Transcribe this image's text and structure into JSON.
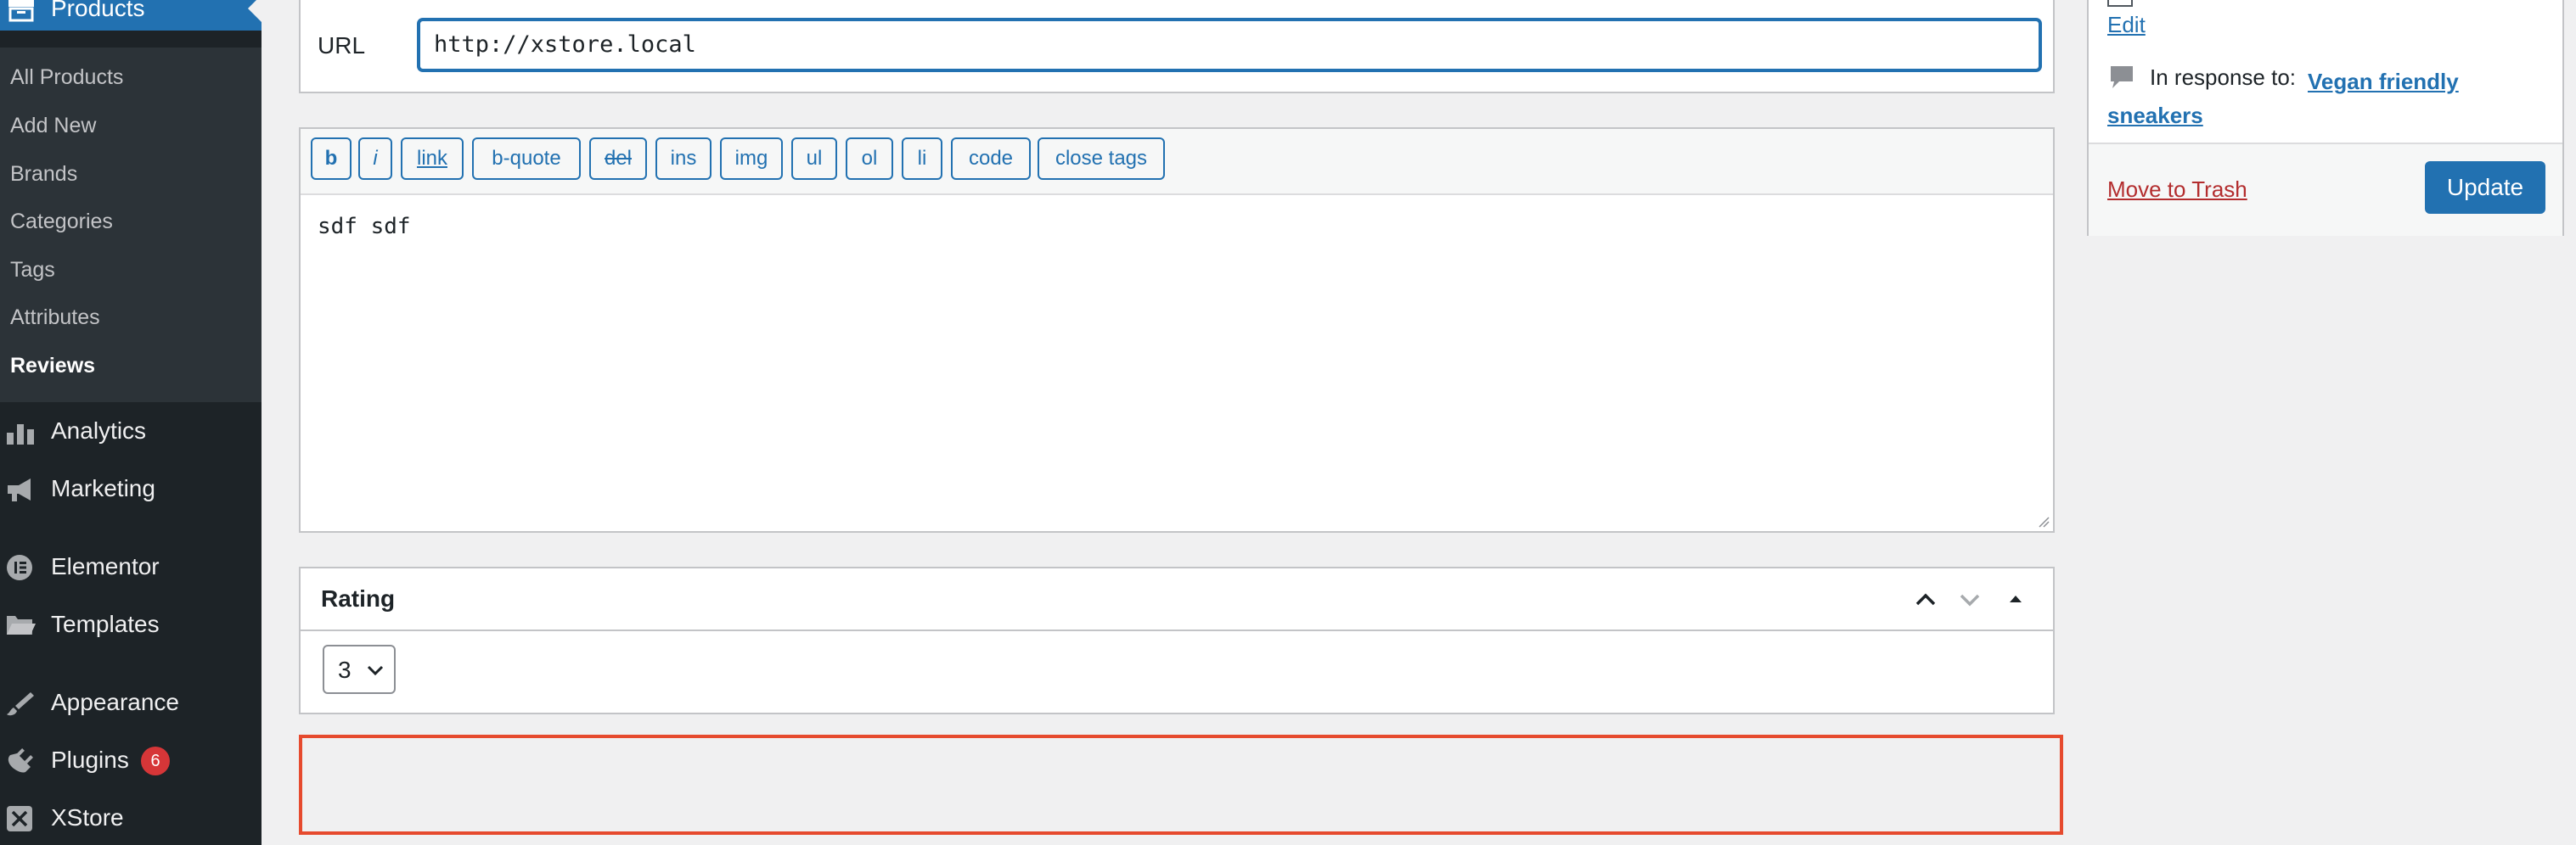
{
  "sidebar": {
    "products_label": "Products",
    "submenu": {
      "all_products": "All Products",
      "add_new": "Add New",
      "brands": "Brands",
      "categories": "Categories",
      "tags": "Tags",
      "attributes": "Attributes",
      "reviews": "Reviews"
    },
    "menu": {
      "analytics": "Analytics",
      "marketing": "Marketing",
      "elementor": "Elementor",
      "templates": "Templates",
      "appearance": "Appearance",
      "plugins": "Plugins",
      "plugins_badge": "6",
      "xstore": "XStore"
    }
  },
  "url_field": {
    "label": "URL",
    "value": "http://xstore.local"
  },
  "editor": {
    "toolbar": {
      "b": "b",
      "i": "i",
      "link": "link",
      "b_quote": "b-quote",
      "del": "del",
      "ins": "ins",
      "img": "img",
      "ul": "ul",
      "ol": "ol",
      "li": "li",
      "code": "code",
      "close_tags": "close tags"
    },
    "content": "sdf sdf"
  },
  "rating_box": {
    "title": "Rating",
    "selected_value": "3"
  },
  "publish_box": {
    "edit_label": "Edit",
    "in_response_to_label": "In response to:",
    "response_link": "Vegan friendly sneakers",
    "trash_label": "Move to Trash",
    "update_label": "Update"
  },
  "colors": {
    "admin_menu_bg": "#1d2327",
    "submenu_bg": "#2c3338",
    "accent": "#2271b1",
    "badge": "#d63638",
    "highlight_border": "#e64a2e",
    "trash": "#b32d2e"
  }
}
